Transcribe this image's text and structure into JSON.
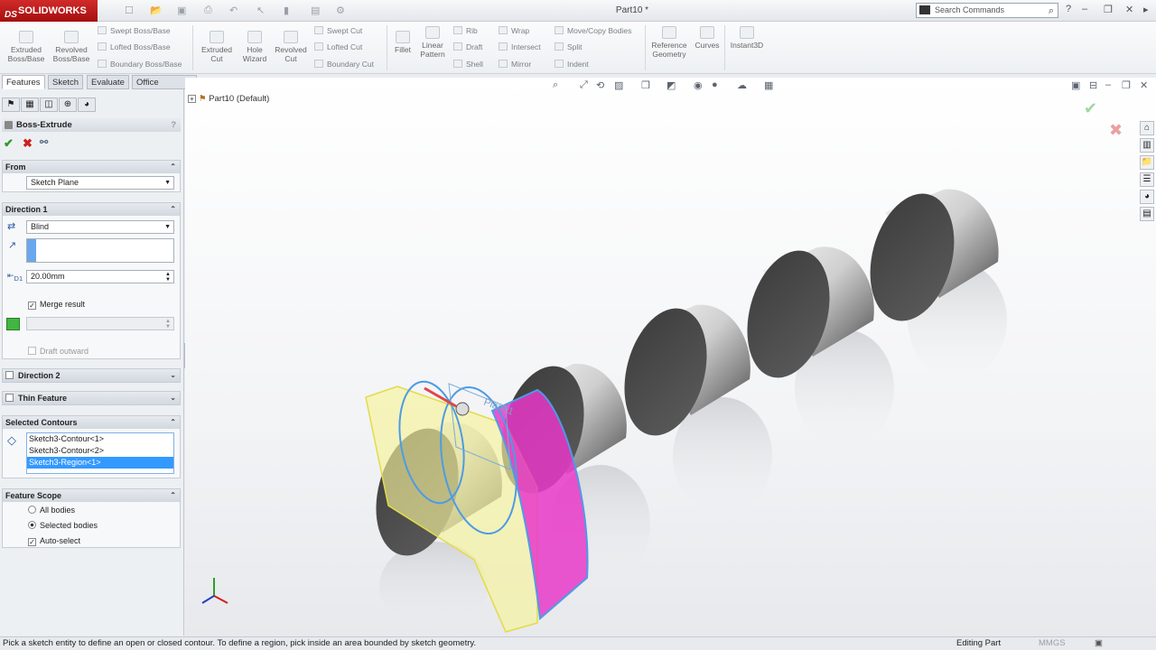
{
  "app": {
    "brand": "SOLIDWORKS",
    "brand_mark": "DS",
    "doc_title": "Part10 *",
    "search_placeholder": "Search Commands"
  },
  "ribbon": {
    "big": [
      {
        "label": "Extruded\nBoss/Base"
      },
      {
        "label": "Revolved\nBoss/Base"
      },
      {
        "label": "Extruded\nCut"
      },
      {
        "label": "Hole\nWizard"
      },
      {
        "label": "Revolved\nCut"
      },
      {
        "label": "Fillet"
      },
      {
        "label": "Linear\nPattern"
      },
      {
        "label": "Reference\nGeometry"
      },
      {
        "label": "Curves"
      },
      {
        "label": "Instant3D"
      }
    ],
    "small": {
      "swept_boss": "Swept Boss/Base",
      "lofted_boss": "Lofted Boss/Base",
      "boundary_boss": "Boundary Boss/Base",
      "swept_cut": "Swept Cut",
      "lofted_cut": "Lofted Cut",
      "boundary_cut": "Boundary Cut",
      "rib": "Rib",
      "draft": "Draft",
      "shell": "Shell",
      "wrap": "Wrap",
      "intersect": "Intersect",
      "mirror": "Mirror",
      "move_copy": "Move/Copy Bodies",
      "split": "Split",
      "indent": "Indent"
    }
  },
  "tabs": [
    "Features",
    "Sketch",
    "Evaluate",
    "Office Products"
  ],
  "pm": {
    "title": "Boss-Extrude",
    "from": {
      "header": "From",
      "value": "Sketch Plane"
    },
    "direction1": {
      "header": "Direction 1",
      "end_condition": "Blind",
      "depth": "20.00mm",
      "depth_symbol": "D1",
      "merge": "Merge result",
      "draft": "Draft outward"
    },
    "direction2": {
      "header": "Direction 2"
    },
    "thin": {
      "header": "Thin Feature"
    },
    "contours": {
      "header": "Selected Contours",
      "items": [
        "Sketch3-Contour<1>",
        "Sketch3-Contour<2>",
        "Sketch3-Region<1>"
      ]
    },
    "scope": {
      "header": "Feature Scope",
      "all": "All bodies",
      "selected": "Selected bodies",
      "auto": "Auto-select"
    }
  },
  "tree": {
    "part": "Part10",
    "config": "(Default)"
  },
  "plane_label": "Plane1",
  "status": {
    "message": "Pick a sketch entity to define an open or closed contour. To define a region, pick inside an area bounded by sketch geometry.",
    "mode": "Editing Part",
    "units": "MMGS"
  },
  "colors": {
    "accent": "#cc1f1f",
    "preview_yellow": "#f6f39a",
    "preview_magenta": "#e838c8",
    "selection_blue": "#3399ff"
  }
}
